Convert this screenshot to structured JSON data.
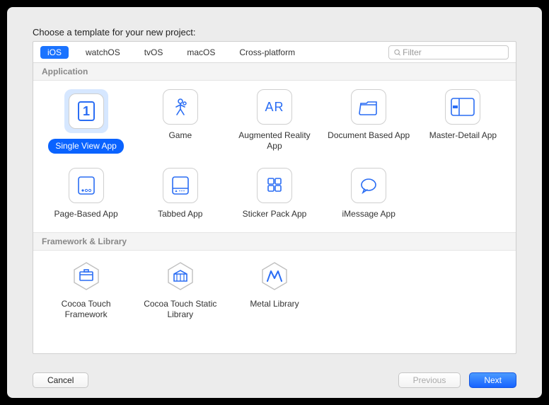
{
  "prompt": "Choose a template for your new project:",
  "tabs": {
    "ios": "iOS",
    "watchos": "watchOS",
    "tvos": "tvOS",
    "macos": "macOS",
    "cross": "Cross-platform"
  },
  "filter": {
    "placeholder": "Filter"
  },
  "sections": {
    "application": "Application",
    "framework": "Framework & Library"
  },
  "app": {
    "singleview": "Single View App",
    "game": "Game",
    "ar": "Augmented Reality App",
    "document": "Document Based App",
    "masterdetail": "Master-Detail App",
    "pagebased": "Page-Based App",
    "tabbed": "Tabbed App",
    "sticker": "Sticker Pack App",
    "imessage": "iMessage App"
  },
  "fw": {
    "cocoatouch": "Cocoa Touch Framework",
    "cocoatouchstatic": "Cocoa Touch Static Library",
    "metal": "Metal Library"
  },
  "buttons": {
    "cancel": "Cancel",
    "previous": "Previous",
    "next": "Next"
  },
  "icons": {
    "ar_text": "AR"
  }
}
